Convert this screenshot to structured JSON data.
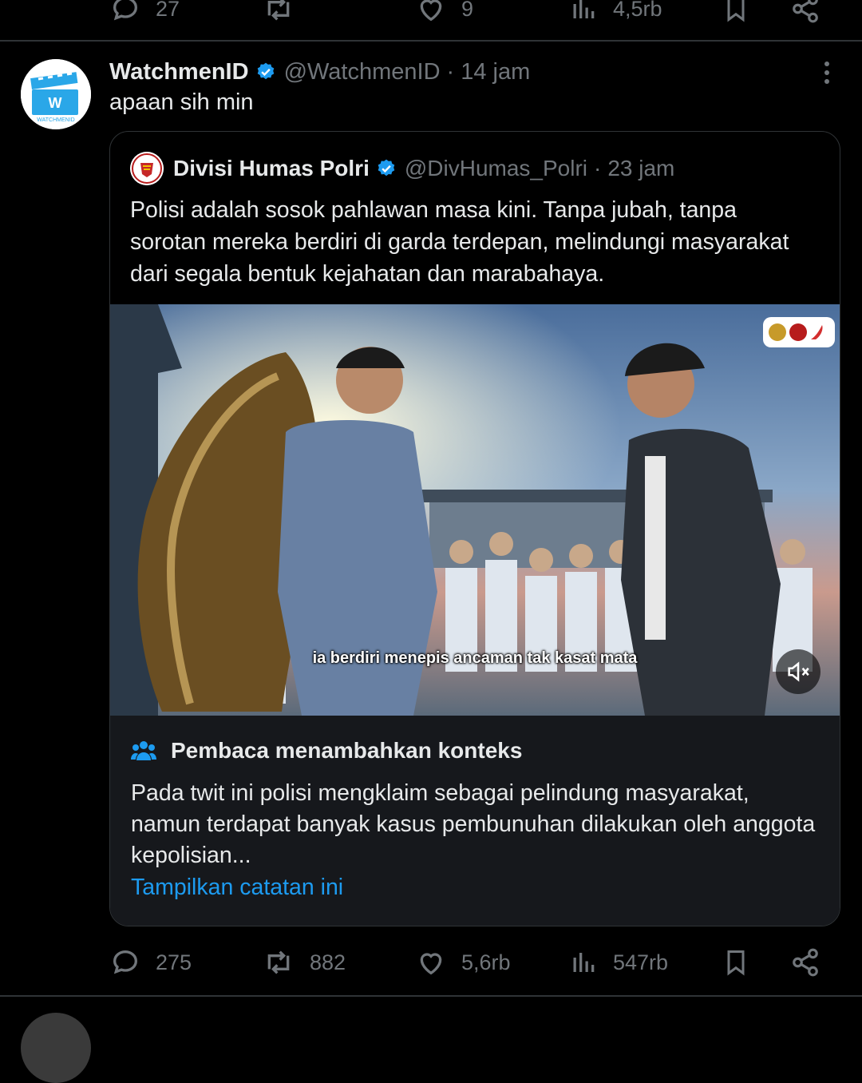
{
  "colors": {
    "background": "#000000",
    "text": "#e7e9ea",
    "muted": "#71767b",
    "accent": "#1d9bf0",
    "border": "#2f3336",
    "note_bg": "#16181c"
  },
  "prev_tweet_actions": {
    "replies": "27",
    "retweets": "",
    "likes": "9",
    "views": "4,5rb"
  },
  "tweet": {
    "name": "WatchmenID",
    "handle": "@WatchmenID",
    "separator": "·",
    "time": "14 jam",
    "text": "apaan sih min",
    "avatar_icon": "clapperboard-icon",
    "avatar_letter": "W",
    "avatar_caption": "WATCHMENID",
    "quote": {
      "name": "Divisi Humas Polri",
      "handle": "@DivHumas_Polri",
      "separator": "·",
      "time": "23 jam",
      "text": "Polisi adalah sosok pahlawan masa kini. Tanpa jubah, tanpa sorotan mereka berdiri di garda terdepan, melindungi masyarakat dari segala bentuk kejahatan dan marabahaya.",
      "video_caption": "ia berdiri menepis ancaman tak kasat mata",
      "mute_icon": "speaker-muted-icon"
    },
    "community_note": {
      "title": "Pembaca menambahkan konteks",
      "icon": "people-icon",
      "text": "Pada twit ini polisi mengklaim sebagai pelindung masyarakat, namun terdapat banyak kasus pembunuhan dilakukan oleh anggota kepolisian...",
      "link": "Tampilkan catatan ini"
    },
    "actions": {
      "replies": "275",
      "retweets": "882",
      "likes": "5,6rb",
      "views": "547rb"
    }
  }
}
